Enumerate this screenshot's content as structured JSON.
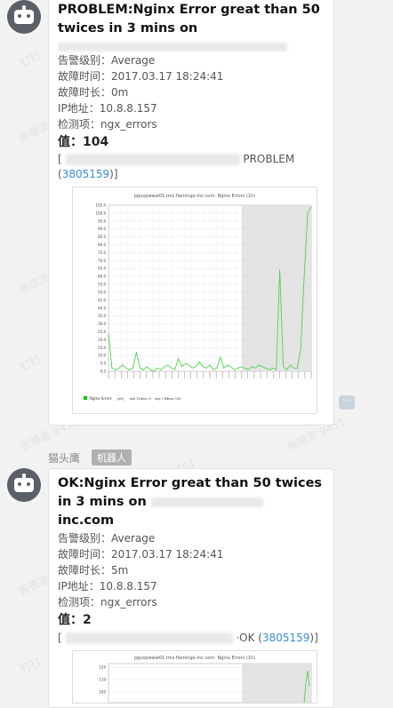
{
  "messages": [
    {
      "title": "PROBLEM:Nginx Error great than 50 twices in 3 mins on",
      "severity": "告警级别：Average",
      "fault_time": "故障时间：2017.03.17 18:24:41",
      "duration": "故障时长：0m",
      "ip": "IP地址：10.8.8.157",
      "item": "检测项：ngx_errors",
      "value": "值：104",
      "status_word": "PROBLEM",
      "event_id": "3805159",
      "chart": {
        "title": "pguopwww01.rmz.flamingo-inc.com: Nginx Errors (1h)",
        "y_ticks": [
          "105.0",
          "100.0",
          "95.0",
          "90.0",
          "85.0",
          "80.0",
          "75.0",
          "70.0",
          "65.0",
          "60.0",
          "55.0",
          "50.0",
          "45.0",
          "40.0",
          "35.0",
          "30.0",
          "25.0",
          "20.0",
          "15.0",
          "10.0",
          "5.0",
          "0.0"
        ],
        "legend": "Nginx Errors",
        "legend_stats": [
          "[all]",
          "last 104",
          "min 0",
          "avg 7.63",
          "max 104"
        ]
      }
    },
    {
      "sender": "猫头鹰",
      "sender_tag": "机器人",
      "title": "OK:Nginx Error great than 50 twices in 3 mins on",
      "title_tail": "inc.com",
      "severity": "告警级别：Average",
      "fault_time": "故障时间：2017.03.17 18:24:41",
      "duration": "故障时长：5m",
      "ip": "IP地址：10.8.8.157",
      "item": "检测项：ngx_errors",
      "value": "值：2",
      "ok_text": "OK",
      "event_id": "3805159",
      "chart": {
        "title": "pguopwww01.rmz.flamingo-inc.com: Nginx Errors (1h)",
        "y_ticks": [
          "120",
          "110",
          "100"
        ]
      }
    }
  ],
  "chart_data": {
    "type": "line",
    "title": "pguopwww01.rmz.flamingo-inc.com: Nginx Errors (1h)",
    "series": [
      {
        "name": "Nginx Errors",
        "values": [
          24,
          2,
          1,
          2,
          4,
          2,
          1,
          2,
          12,
          2,
          1,
          3,
          1,
          0,
          2,
          1,
          3,
          4,
          2,
          1,
          8,
          3,
          5,
          4,
          2,
          3,
          6,
          3,
          2,
          4,
          1,
          2,
          9,
          2,
          4,
          3,
          1,
          2,
          3,
          2,
          1,
          3,
          2,
          4,
          3,
          2,
          1,
          2,
          1,
          64,
          3,
          1,
          4,
          2,
          2,
          14,
          60,
          100,
          104
        ],
        "color": "#00c800"
      }
    ],
    "ylim": [
      0,
      105
    ],
    "grid": true
  }
}
